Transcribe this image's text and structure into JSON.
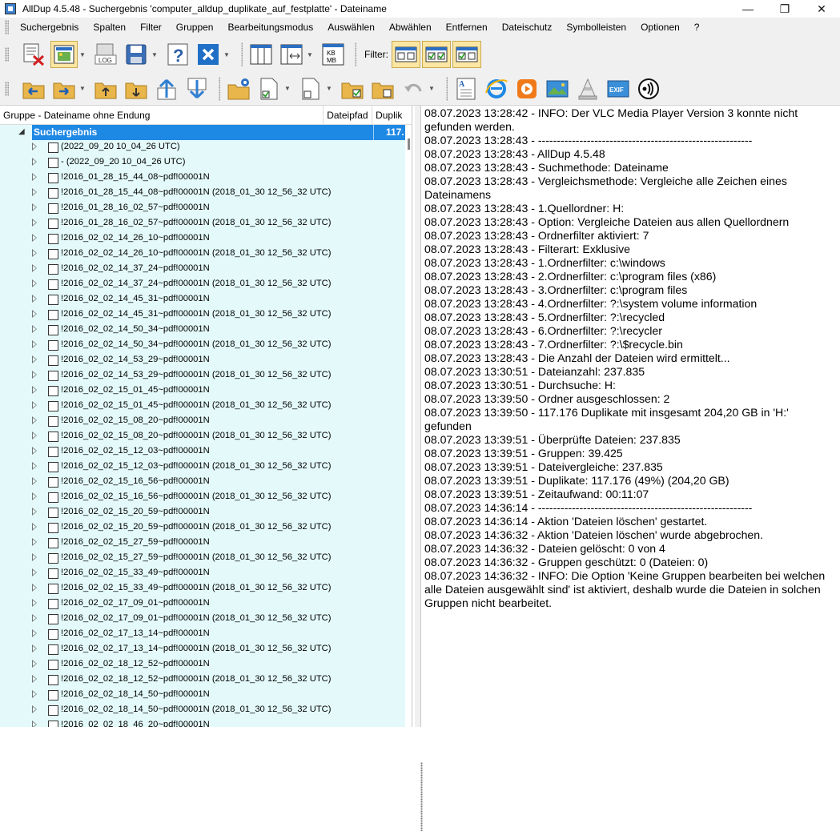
{
  "window": {
    "title": "AllDup 4.5.48 - Suchergebnis 'computer_alldup_duplikate_auf_festplatte' - Dateiname",
    "minimize": "—",
    "maximize": "❐",
    "close": "✕"
  },
  "menu": [
    "Suchergebnis",
    "Spalten",
    "Filter",
    "Gruppen",
    "Bearbeitungsmodus",
    "Auswählen",
    "Abwählen",
    "Entfernen",
    "Dateischutz",
    "Symbolleisten",
    "Optionen",
    "?"
  ],
  "toolbar": {
    "filter_label": "Filter:",
    "log_label": "LOG",
    "kb_label": "KB",
    "mb_label": "MB",
    "exif_label": "EXIF"
  },
  "columns": {
    "group": "Gruppe - Dateiname ohne Endung",
    "path": "Dateipfad",
    "dup": "Duplik"
  },
  "tree": {
    "root_label": "Suchergebnis",
    "root_count": "117.",
    "rows": [
      " (2022_09_20 10_04_26 UTC)",
      "- (2022_09_20 10_04_26 UTC)",
      "!2016_01_28_15_44_08~pdf!00001N",
      "!2016_01_28_15_44_08~pdf!00001N (2018_01_30 12_56_32 UTC)",
      "!2016_01_28_16_02_57~pdf!00001N",
      "!2016_01_28_16_02_57~pdf!00001N (2018_01_30 12_56_32 UTC)",
      "!2016_02_02_14_26_10~pdf!00001N",
      "!2016_02_02_14_26_10~pdf!00001N (2018_01_30 12_56_32 UTC)",
      "!2016_02_02_14_37_24~pdf!00001N",
      "!2016_02_02_14_37_24~pdf!00001N (2018_01_30 12_56_32 UTC)",
      "!2016_02_02_14_45_31~pdf!00001N",
      "!2016_02_02_14_45_31~pdf!00001N (2018_01_30 12_56_32 UTC)",
      "!2016_02_02_14_50_34~pdf!00001N",
      "!2016_02_02_14_50_34~pdf!00001N (2018_01_30 12_56_32 UTC)",
      "!2016_02_02_14_53_29~pdf!00001N",
      "!2016_02_02_14_53_29~pdf!00001N (2018_01_30 12_56_32 UTC)",
      "!2016_02_02_15_01_45~pdf!00001N",
      "!2016_02_02_15_01_45~pdf!00001N (2018_01_30 12_56_32 UTC)",
      "!2016_02_02_15_08_20~pdf!00001N",
      "!2016_02_02_15_08_20~pdf!00001N (2018_01_30 12_56_32 UTC)",
      "!2016_02_02_15_12_03~pdf!00001N",
      "!2016_02_02_15_12_03~pdf!00001N (2018_01_30 12_56_32 UTC)",
      "!2016_02_02_15_16_56~pdf!00001N",
      "!2016_02_02_15_16_56~pdf!00001N (2018_01_30 12_56_32 UTC)",
      "!2016_02_02_15_20_59~pdf!00001N",
      "!2016_02_02_15_20_59~pdf!00001N (2018_01_30 12_56_32 UTC)",
      "!2016_02_02_15_27_59~pdf!00001N",
      "!2016_02_02_15_27_59~pdf!00001N (2018_01_30 12_56_32 UTC)",
      "!2016_02_02_15_33_49~pdf!00001N",
      "!2016_02_02_15_33_49~pdf!00001N (2018_01_30 12_56_32 UTC)",
      "!2016_02_02_17_09_01~pdf!00001N",
      "!2016_02_02_17_09_01~pdf!00001N (2018_01_30 12_56_32 UTC)",
      "!2016_02_02_17_13_14~pdf!00001N",
      "!2016_02_02_17_13_14~pdf!00001N (2018_01_30 12_56_32 UTC)",
      "!2016_02_02_18_12_52~pdf!00001N",
      "!2016_02_02_18_12_52~pdf!00001N (2018_01_30 12_56_32 UTC)",
      "!2016_02_02_18_14_50~pdf!00001N",
      "!2016_02_02_18_14_50~pdf!00001N (2018_01_30 12_56_32 UTC)",
      "!2016_02_02_18_46_20~pdf!00001N"
    ]
  },
  "log": [
    "08.07.2023 13:28:42 - INFO: Der VLC Media Player Version 3 konnte nicht gefunden werden.",
    "08.07.2023 13:28:43 - ---------------------------------------------------------",
    "08.07.2023 13:28:43 - AllDup 4.5.48",
    "08.07.2023 13:28:43 - Suchmethode: Dateiname",
    "08.07.2023 13:28:43 - Vergleichsmethode: Vergleiche alle Zeichen eines Dateinamens",
    "08.07.2023 13:28:43 - 1.Quellordner: H:",
    "08.07.2023 13:28:43 - Option: Vergleiche Dateien aus allen Quellordnern",
    "08.07.2023 13:28:43 - Ordnerfilter aktiviert: 7",
    "08.07.2023 13:28:43 - Filterart: Exklusive",
    "08.07.2023 13:28:43 - 1.Ordnerfilter: c:\\windows",
    "08.07.2023 13:28:43 - 2.Ordnerfilter: c:\\program files (x86)",
    "08.07.2023 13:28:43 - 3.Ordnerfilter: c:\\program files",
    "08.07.2023 13:28:43 - 4.Ordnerfilter: ?:\\system volume information",
    "08.07.2023 13:28:43 - 5.Ordnerfilter: ?:\\recycled",
    "08.07.2023 13:28:43 - 6.Ordnerfilter: ?:\\recycler",
    "08.07.2023 13:28:43 - 7.Ordnerfilter: ?:\\$recycle.bin",
    "08.07.2023 13:28:43 - Die Anzahl der Dateien wird ermittelt...",
    "08.07.2023 13:30:51 - Dateianzahl: 237.835",
    "08.07.2023 13:30:51 - Durchsuche: H:",
    "08.07.2023 13:39:50 - Ordner ausgeschlossen: 2",
    "08.07.2023 13:39:50 - 117.176 Duplikate mit insgesamt 204,20 GB in 'H:' gefunden",
    "08.07.2023 13:39:51 - Überprüfte Dateien: 237.835",
    "08.07.2023 13:39:51 - Gruppen: 39.425",
    "08.07.2023 13:39:51 - Dateivergleiche: 237.835",
    "08.07.2023 13:39:51 - Duplikate: 117.176 (49%) (204,20 GB)",
    "08.07.2023 13:39:51 - Zeitaufwand: 00:11:07",
    "08.07.2023 14:36:14 - ---------------------------------------------------------",
    "08.07.2023 14:36:14 - Aktion 'Dateien löschen' gestartet.",
    "08.07.2023 14:36:32 - Aktion 'Dateien löschen' wurde abgebrochen.",
    "08.07.2023 14:36:32 - Dateien gelöscht: 0 von 4",
    "08.07.2023 14:36:32 - Gruppen geschützt: 0 (Dateien: 0)",
    "08.07.2023 14:36:32 - INFO: Die Option 'Keine Gruppen bearbeiten bei welchen alle Dateien ausgewählt sind' ist aktiviert, deshalb wurde die Dateien in solchen Gruppen nicht bearbeitet."
  ]
}
